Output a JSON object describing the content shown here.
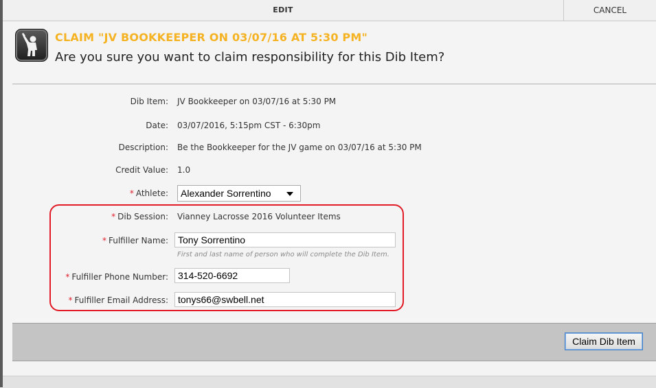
{
  "tabs": {
    "edit_label": "EDIT",
    "cancel_label": "CANCEL"
  },
  "header": {
    "icon": "volunteer-raising-hand-icon",
    "title": "CLAIM \"JV BOOKKEEPER ON 03/07/16 AT 5:30 PM\"",
    "question": "Are you sure you want to claim responsibility for this Dib Item?"
  },
  "details": {
    "dib_item": {
      "label": "Dib Item:",
      "value": "JV Bookkeeper on 03/07/16 at 5:30 PM"
    },
    "date": {
      "label": "Date:",
      "value": "03/07/2016, 5:15pm CST - 6:30pm"
    },
    "description": {
      "label": "Description:",
      "value": "Be the Bookkeeper for the JV game on 03/07/16 at 5:30 PM"
    },
    "credit_value": {
      "label": "Credit Value:",
      "value": "1.0"
    }
  },
  "form": {
    "required_marker": "*",
    "athlete": {
      "label": "Athlete:",
      "selected": "Alexander Sorrentino"
    },
    "dib_session": {
      "label": "Dib Session:",
      "value": "Vianney Lacrosse 2016 Volunteer Items"
    },
    "fulfiller_name": {
      "label": "Fulfiller Name:",
      "value": "Tony Sorrentino",
      "hint": "First and last name of person who will complete the Dib Item."
    },
    "fulfiller_phone": {
      "label": "Fulfiller Phone Number:",
      "value": "314-520-6692"
    },
    "fulfiller_email": {
      "label": "Fulfiller Email Address:",
      "value": "tonys66@swbell.net"
    }
  },
  "footer": {
    "claim_button": "Claim Dib Item"
  },
  "colors": {
    "title": "#f5b324",
    "required": "#e0202a",
    "highlight": "#e11a25",
    "button_border": "#3f7fc8"
  }
}
